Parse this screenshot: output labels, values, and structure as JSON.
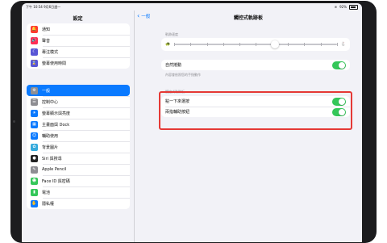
{
  "status": {
    "time_date": "下午 10:54  9月6日週一",
    "battery_percent": "92%"
  },
  "sidebar": {
    "title": "設定",
    "groups": [
      [
        {
          "label": "通知",
          "icon": "bell-icon",
          "color": "#ff3b30"
        },
        {
          "label": "聲音",
          "icon": "speaker-icon",
          "color": "#ff2d55"
        },
        {
          "label": "專注模式",
          "icon": "moon-icon",
          "color": "#5856d6"
        },
        {
          "label": "螢幕使用時間",
          "icon": "hourglass-icon",
          "color": "#5856d6"
        }
      ],
      [
        {
          "label": "一般",
          "icon": "gear-icon",
          "color": "#8e8e93",
          "selected": true
        },
        {
          "label": "控制中心",
          "icon": "toggles-icon",
          "color": "#8e8e93"
        },
        {
          "label": "螢幕顯示與亮度",
          "icon": "brightness-icon",
          "color": "#0a7aff"
        },
        {
          "label": "主畫面與 Dock",
          "icon": "grid-icon",
          "color": "#0a7aff"
        },
        {
          "label": "輔助使用",
          "icon": "accessibility-icon",
          "color": "#0a7aff"
        },
        {
          "label": "背景圖片",
          "icon": "flower-icon",
          "color": "#34aadc"
        },
        {
          "label": "Siri 與搜尋",
          "icon": "siri-icon",
          "color": "#222222"
        },
        {
          "label": "Apple Pencil",
          "icon": "pencil-icon",
          "color": "#8e8e93"
        },
        {
          "label": "Face ID 與密碼",
          "icon": "faceid-icon",
          "color": "#34c759"
        },
        {
          "label": "電池",
          "icon": "battery-icon",
          "color": "#34c759"
        },
        {
          "label": "隱私權",
          "icon": "hand-icon",
          "color": "#0a7aff"
        }
      ]
    ]
  },
  "detail": {
    "back_label": "一般",
    "title": "觸控式軌跡板",
    "tracking_speed_label": "軌跡速度",
    "tracking_speed_value": 0.62,
    "natural_scrolling_label": "自然捲動",
    "natural_scrolling_on": true,
    "natural_scrolling_footer": "內容會依照您的手指動作",
    "section_header": "觸控式軌跡板",
    "tap_to_click_label": "點一下來選按",
    "tap_to_click_on": true,
    "two_finger_click_label": "兩指輔助按鈕",
    "two_finger_click_on": true
  },
  "colors": {
    "accent": "#0a7aff",
    "toggle_on": "#34c759",
    "highlight": "#e53935"
  }
}
